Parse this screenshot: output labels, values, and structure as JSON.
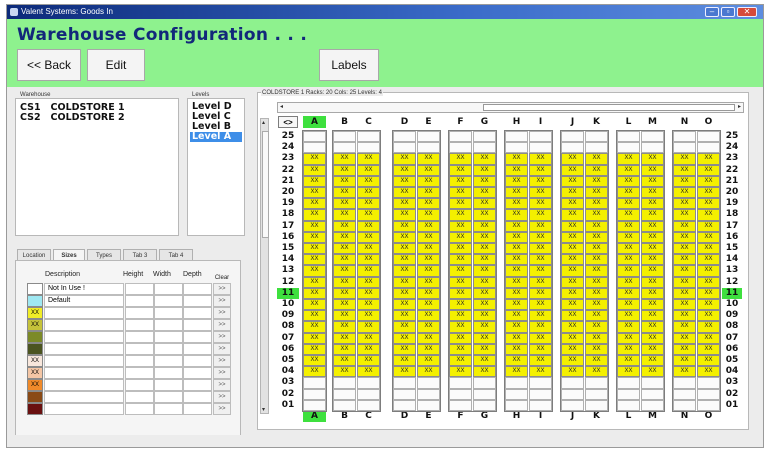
{
  "window": {
    "title": "Valent Systems: Goods In",
    "controls": [
      "–",
      "▫",
      "✕"
    ]
  },
  "header": {
    "title": "Warehouse Configuration . . .",
    "buttons": {
      "back": "<< Back",
      "edit": "Edit",
      "labels": "Labels"
    }
  },
  "warehouse": {
    "group_label": "Warehouse",
    "items": [
      {
        "code": "CS1",
        "name": "COLDSTORE 1"
      },
      {
        "code": "CS2",
        "name": "COLDSTORE 2"
      }
    ]
  },
  "levels": {
    "group_label": "Levels",
    "items": [
      "Level D",
      "Level C",
      "Level B",
      "Level A"
    ],
    "selected": "Level A"
  },
  "tabs": {
    "items": [
      "Location",
      "Sizes",
      "Types",
      "Tab 3",
      "Tab 4"
    ],
    "active": "Sizes"
  },
  "sizes": {
    "columns": {
      "description": "Description",
      "height": "Height",
      "width": "Width",
      "depth": "Depth",
      "clear": "Clear"
    },
    "go_label": ">>",
    "rows": [
      {
        "swatch_color": "#ffffff",
        "swatch_text": "",
        "description": "Not In Use !"
      },
      {
        "swatch_color": "#9fe8f2",
        "swatch_text": "",
        "description": "Default"
      },
      {
        "swatch_color": "#f1ed27",
        "swatch_text": "XX",
        "description": ""
      },
      {
        "swatch_color": "#c5c23a",
        "swatch_text": "XX",
        "description": ""
      },
      {
        "swatch_color": "#7c8a27",
        "swatch_text": "",
        "description": ""
      },
      {
        "swatch_color": "#4b5420",
        "swatch_text": "",
        "description": ""
      },
      {
        "swatch_color": "#f8e7dc",
        "swatch_text": "XX",
        "description": ""
      },
      {
        "swatch_color": "#f4c6a5",
        "swatch_text": "XX",
        "description": ""
      },
      {
        "swatch_color": "#f08a2a",
        "swatch_text": "XX",
        "description": ""
      },
      {
        "swatch_color": "#8a4a16",
        "swatch_text": "",
        "description": ""
      },
      {
        "swatch_color": "#6a1010",
        "swatch_text": "",
        "description": ""
      }
    ]
  },
  "grid": {
    "info": "COLDSTORE 1     Racks: 20  Cols: 25  Levels: 4",
    "corner_label": "<>",
    "columns": [
      "A",
      "B",
      "C",
      "D",
      "E",
      "F",
      "G",
      "H",
      "I",
      "J",
      "K",
      "L",
      "M",
      "N",
      "O"
    ],
    "selected_column": "A",
    "rows": [
      "25",
      "24",
      "23",
      "22",
      "21",
      "20",
      "19",
      "18",
      "17",
      "16",
      "15",
      "14",
      "13",
      "12",
      "11",
      "10",
      "09",
      "08",
      "07",
      "06",
      "05",
      "04",
      "03",
      "02",
      "01"
    ],
    "selected_row": "11",
    "filled_rows": [
      "23",
      "22",
      "21",
      "20",
      "19",
      "18",
      "17",
      "16",
      "15",
      "14",
      "13",
      "12",
      "11",
      "10",
      "09",
      "08",
      "07",
      "06",
      "05",
      "04"
    ],
    "slot_text": "XX",
    "colors": {
      "slot": "#f4f000",
      "highlight": "#3ee03e",
      "header": "#8ef28e",
      "title": "#12287a",
      "selection": "#3e8ee8"
    }
  }
}
